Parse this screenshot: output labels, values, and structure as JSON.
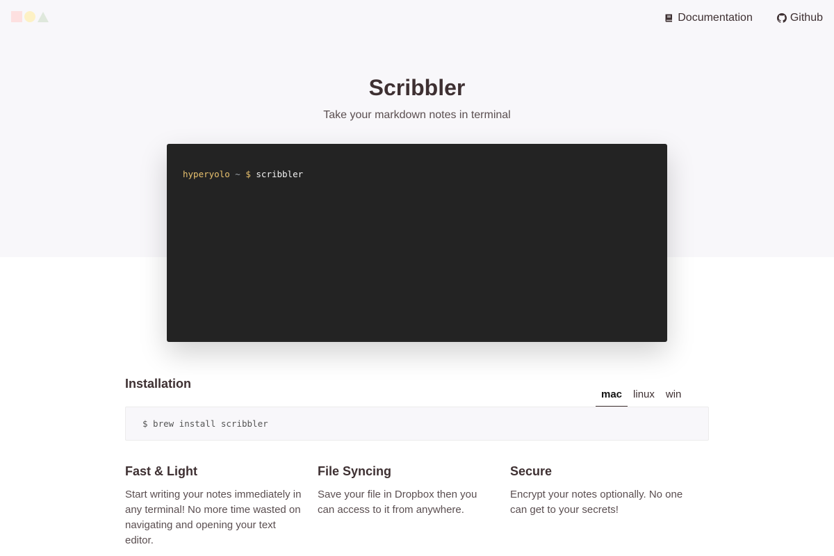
{
  "nav": {
    "documentation_label": "Documentation",
    "github_label": "Github",
    "documentation_icon": "book-icon",
    "github_icon": "github-icon"
  },
  "hero": {
    "title": "Scribbler",
    "subtitle": "Take your markdown notes in terminal"
  },
  "terminal": {
    "user": "hyperyolo",
    "path": "~",
    "prompt": "$",
    "command": "scribbler"
  },
  "installation": {
    "title": "Installation",
    "tabs": [
      "mac",
      "linux",
      "win"
    ],
    "active_tab": "mac",
    "command": "$ brew install scribbler"
  },
  "features": [
    {
      "title": "Fast & Light",
      "text": "Start writing your notes immediately in any terminal! No more time wasted on navigating and opening your text editor."
    },
    {
      "title": "File Syncing",
      "text": "Save your file in Dropbox then you can access to it from anywhere."
    },
    {
      "title": "Secure",
      "text": "Encrypt your notes optionally. No one can get to your secrets!"
    }
  ],
  "colors": {
    "background": "#ffffff",
    "hero_background": "#f8f7fa",
    "terminal_background": "#232323",
    "text": "#3e3032",
    "prompt": "#e8c16e"
  }
}
